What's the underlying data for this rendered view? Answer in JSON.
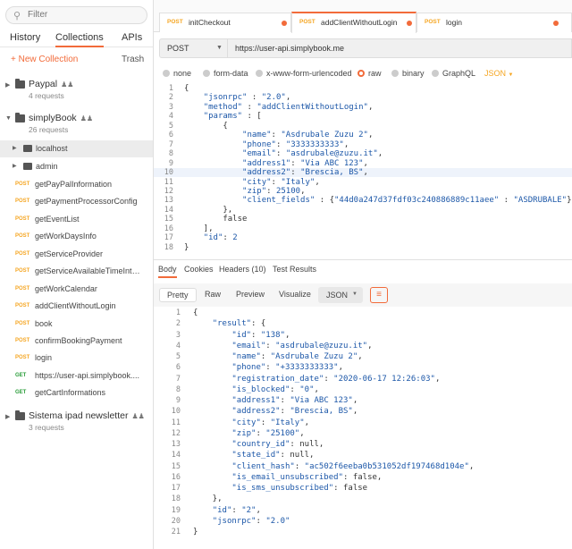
{
  "sidebar": {
    "search_placeholder": "Filter",
    "tabs": [
      "History",
      "Collections",
      "APIs"
    ],
    "new_collection": "+ New Collection",
    "trash": "Trash",
    "collections": [
      {
        "name": "Paypal",
        "count": "4 requests"
      },
      {
        "name": "simplyBook",
        "count": "26 requests"
      },
      {
        "name": "Sistema ipad newsletter",
        "count": "3 requests"
      }
    ],
    "folders": [
      "localhost",
      "admin"
    ],
    "requests": [
      {
        "method": "POST",
        "label": "getPayPalInformation"
      },
      {
        "method": "POST",
        "label": "getPaymentProcessorConfig"
      },
      {
        "method": "POST",
        "label": "getEventList"
      },
      {
        "method": "POST",
        "label": "getWorkDaysInfo"
      },
      {
        "method": "POST",
        "label": "getServiceProvider"
      },
      {
        "method": "POST",
        "label": "getServiceAvailableTimeInter..."
      },
      {
        "method": "POST",
        "label": "getWorkCalendar"
      },
      {
        "method": "POST",
        "label": "addClientWithoutLogin"
      },
      {
        "method": "POST",
        "label": "book"
      },
      {
        "method": "POST",
        "label": "confirmBookingPayment"
      },
      {
        "method": "POST",
        "label": "login"
      },
      {
        "method": "GET",
        "label": "https://user-api.simplybook...."
      },
      {
        "method": "GET",
        "label": "getCartInformations"
      }
    ]
  },
  "tabs": [
    {
      "method": "POST",
      "name": "initCheckout"
    },
    {
      "method": "POST",
      "name": "addClientWithoutLogin"
    },
    {
      "method": "POST",
      "name": "login"
    }
  ],
  "request": {
    "method": "POST",
    "url": "https://user-api.simplybook.me"
  },
  "body_options": [
    "none",
    "form-data",
    "x-www-form-urlencoded",
    "raw",
    "binary",
    "GraphQL"
  ],
  "body_format": "JSON",
  "request_body_lines": [
    "{",
    "    \"jsonrpc\" : \"2.0\",",
    "    \"method\" : \"addClientWithoutLogin\",",
    "    \"params\" : [",
    "        {",
    "            \"name\": \"Asdrubale Zuzu 2\",",
    "            \"phone\": \"3333333333\",",
    "            \"email\": \"asdrubale@zuzu.it\",",
    "            \"address1\": \"Via ABC 123\",",
    "            \"address2\": \"Brescia, BS\",",
    "            \"city\": \"Italy\",",
    "            \"zip\": 25100,",
    "            \"client_fields\" : {\"44d0a247d37fdf03c240886889c11aee\" : \"ASDRUBALE\"}",
    "        },",
    "        false",
    "    ],",
    "    \"id\": 2",
    "}"
  ],
  "response_tabs": [
    "Body",
    "Cookies",
    "Headers (10)",
    "Test Results"
  ],
  "response_views": [
    "Pretty",
    "Raw",
    "Preview",
    "Visualize"
  ],
  "response_format": "JSON",
  "response_lines": [
    "{",
    "    \"result\": {",
    "        \"id\": \"138\",",
    "        \"email\": \"asdrubale@zuzu.it\",",
    "        \"name\": \"Asdrubale Zuzu 2\",",
    "        \"phone\": \"+3333333333\",",
    "        \"registration_date\": \"2020-06-17 12:26:03\",",
    "        \"is_blocked\": \"0\",",
    "        \"address1\": \"Via ABC 123\",",
    "        \"address2\": \"Brescia, BS\",",
    "        \"city\": \"Italy\",",
    "        \"zip\": \"25100\",",
    "        \"country_id\": null,",
    "        \"state_id\": null,",
    "        \"client_hash\": \"ac502f6eeba0b531052df197468d104e\",",
    "        \"is_email_unsubscribed\": false,",
    "        \"is_sms_unsubscribed\": false",
    "    },",
    "    \"id\": \"2\",",
    "    \"jsonrpc\": \"2.0\"",
    "}"
  ]
}
